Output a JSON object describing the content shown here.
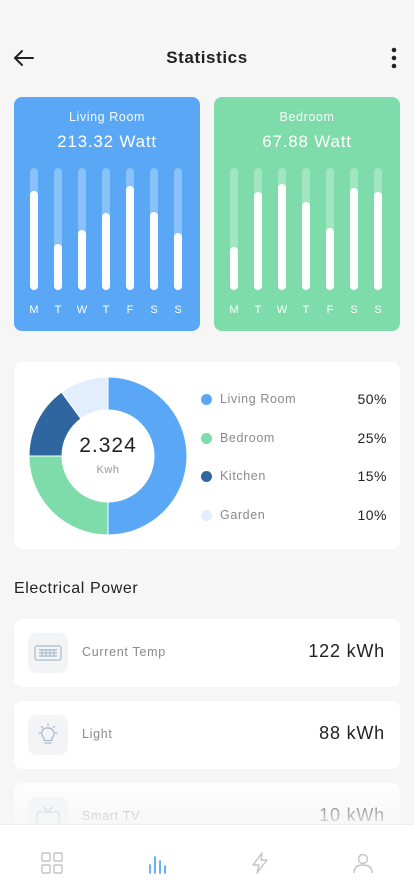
{
  "header": {
    "title": "Statistics",
    "back_icon": "arrow-left-icon",
    "more_icon": "more-vertical-icon"
  },
  "rooms": [
    {
      "name": "Living Room",
      "watt": "213.32 Watt",
      "color": "#5aa8f5",
      "days": [
        "M",
        "T",
        "W",
        "T",
        "F",
        "S",
        "S"
      ],
      "levels": [
        0.81,
        0.38,
        0.49,
        0.63,
        0.85,
        0.64,
        0.47
      ]
    },
    {
      "name": "Bedroom",
      "watt": "67.88 Watt",
      "color": "#7ddcaa",
      "days": [
        "M",
        "T",
        "W",
        "T",
        "F",
        "S",
        "S"
      ],
      "levels": [
        0.35,
        0.8,
        0.87,
        0.72,
        0.51,
        0.84,
        0.8
      ]
    }
  ],
  "chart_data": {
    "type": "pie",
    "center_value": "2.324",
    "center_unit": "Kwh",
    "categories": [
      "Living Room",
      "Bedroom",
      "Kitchen",
      "Garden"
    ],
    "values": [
      50,
      25,
      15,
      10
    ],
    "value_labels": [
      "50%",
      "25%",
      "15%",
      "10%"
    ],
    "colors": [
      "#5aa8f5",
      "#7ddcaa",
      "#2f66a0",
      "#e2eefc"
    ]
  },
  "power": {
    "section_title": "Electrical Power",
    "items": [
      {
        "label": "Current Temp",
        "value": "122 kWh",
        "icon": "keyboard-icon"
      },
      {
        "label": "Light",
        "value": "88 kWh",
        "icon": "lightbulb-icon"
      },
      {
        "label": "Smart TV",
        "value": "10 kWh",
        "icon": "tv-icon"
      }
    ]
  },
  "nav": {
    "items": [
      {
        "icon": "grid-icon",
        "active": false
      },
      {
        "icon": "bar-chart-icon",
        "active": true
      },
      {
        "icon": "lightning-icon",
        "active": false
      },
      {
        "icon": "user-icon",
        "active": false
      }
    ],
    "active_color": "#5aa8f5",
    "inactive_color": "#c4c4c4"
  }
}
